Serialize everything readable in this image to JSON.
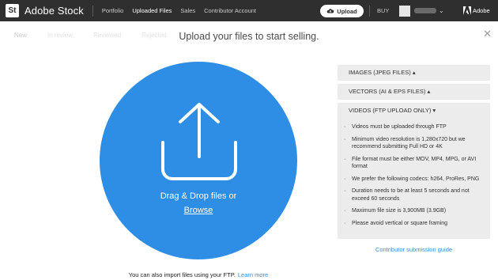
{
  "topbar": {
    "logo": "St",
    "brand": "Adobe Stock",
    "nav": [
      "Portfolio",
      "Uploaded Files",
      "Sales",
      "Contributor Account"
    ],
    "active_nav": "Uploaded Files",
    "upload_label": "Upload",
    "buy_label": "BUY",
    "adobe_label": "Adobe"
  },
  "tabs": [
    "New",
    "In review",
    "Reviewed",
    "Rejected"
  ],
  "heading": "Upload your files to start selling.",
  "dropzone": {
    "text": "Drag & Drop files or",
    "browse": "Browse",
    "color": "#2e8ee6"
  },
  "ftp": {
    "text": "You can also import files using your FTP.",
    "link": "Learn more"
  },
  "panel": {
    "images_header": "IMAGES (JPEG FILES) ▴",
    "vectors_header": "VECTORS (AI & EPS FILES) ▴",
    "videos_header": "VIDEOS (FTP UPLOAD ONLY) ▾",
    "videos_items": [
      "Videos must be uploaded through FTP",
      "Minimum video resolution is 1,280x720 but we recommend submitting Full HD or 4K",
      "File format must be either MOV, MP4, MPG, or AVI format",
      "We prefer the following codecs: h264, ProRes, PNG",
      "Duration needs to be at least 5 seconds and not exceed 60 seconds",
      "Maximum file size is 3,900MB (3.9GB)",
      "Please avoid vertical or square framing"
    ],
    "guide_link": "Contributor submission guide"
  }
}
